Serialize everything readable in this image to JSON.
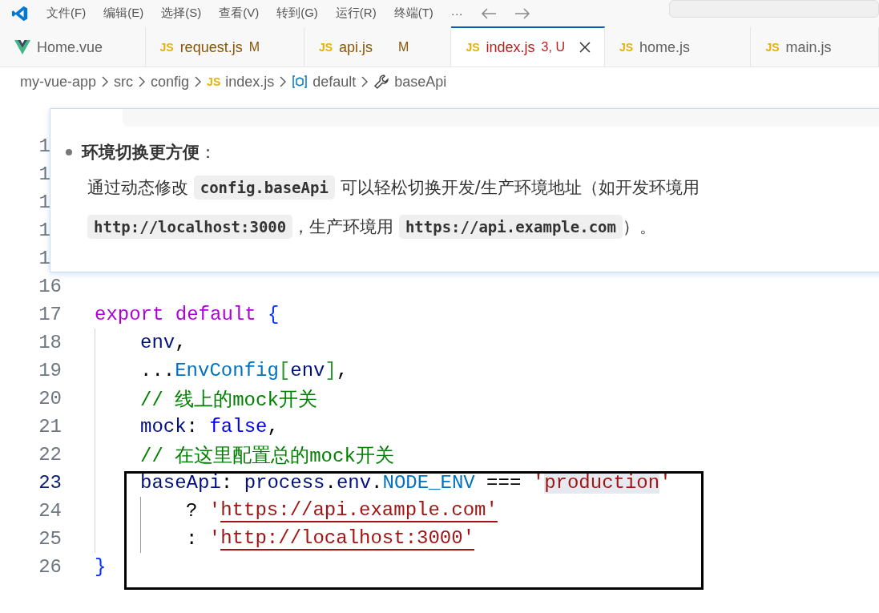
{
  "menu_bar": {
    "items": [
      "文件(F)",
      "编辑(E)",
      "选择(S)",
      "查看(V)",
      "转到(G)",
      "运行(R)",
      "终端(T)",
      "···"
    ]
  },
  "tabs": [
    {
      "label": "Home.vue",
      "selected": false,
      "error": false
    },
    {
      "label": "request.js",
      "icon_text": "JS",
      "status": "M",
      "selected": false,
      "error": false
    },
    {
      "label": "api.js",
      "icon_text": "JS",
      "status": "M",
      "selected": false,
      "error": false
    },
    {
      "label": "index.js",
      "icon_text": "JS",
      "status": "3, U",
      "selected": true,
      "error": true
    },
    {
      "label": "home.js",
      "icon_text": "JS",
      "selected": false,
      "error": false
    },
    {
      "label": "main.js",
      "icon_text": "JS",
      "selected": false,
      "error": false
    }
  ],
  "breadcrumb": [
    {
      "label": "my-vue-app",
      "kind": "folder"
    },
    {
      "label": "src",
      "kind": "folder"
    },
    {
      "label": "config",
      "kind": "folder"
    },
    {
      "label": "index.js",
      "kind": "file",
      "icon_text": "JS"
    },
    {
      "label": "default",
      "kind": "module"
    },
    {
      "label": "baseApi",
      "kind": "property"
    }
  ],
  "editor": {
    "covered_line_numbers": [
      "1",
      "1",
      "1",
      "1",
      "1"
    ],
    "lines": [
      {
        "number": "16",
        "current": false
      },
      {
        "number": "17",
        "current": false,
        "tokens": [
          {
            "text": "export default ",
            "kind": "keyword"
          },
          {
            "text": "{",
            "kind": "brace"
          }
        ],
        "children": [
          {
            "number": "18",
            "current": false,
            "tokens": [
              {
                "text": "env",
                "kind": "variable"
              },
              {
                "text": ",",
                "kind": "plain"
              }
            ]
          },
          {
            "number": "19",
            "current": false,
            "tokens": [
              {
                "text": "...",
                "kind": "plain"
              },
              {
                "text": "EnvConfig",
                "kind": "constant"
              },
              {
                "text": "[",
                "kind": "bracket"
              },
              {
                "text": "env",
                "kind": "variable"
              },
              {
                "text": "]",
                "kind": "bracket"
              },
              {
                "text": ",",
                "kind": "plain"
              }
            ]
          },
          {
            "number": "20",
            "current": false,
            "tokens": [
              {
                "text": "// 线上的mock开关",
                "kind": "comment"
              }
            ]
          },
          {
            "number": "21",
            "current": false,
            "tokens": [
              {
                "text": "mock",
                "kind": "variable"
              },
              {
                "text": ": ",
                "kind": "plain"
              },
              {
                "text": "false",
                "kind": "boolean"
              },
              {
                "text": ",",
                "kind": "plain"
              }
            ]
          },
          {
            "number": "22",
            "current": false,
            "tokens": [
              {
                "text": "// 在这里配置总的mock开关",
                "kind": "comment"
              }
            ]
          },
          {
            "number": "23",
            "current": true,
            "tokens": [
              {
                "text": "baseApi",
                "kind": "variable"
              },
              {
                "text": ": ",
                "kind": "plain"
              },
              {
                "text": "process",
                "kind": "variable"
              },
              {
                "text": ".",
                "kind": "plain"
              },
              {
                "text": "env",
                "kind": "variable"
              },
              {
                "text": ".",
                "kind": "plain"
              },
              {
                "text": "NODE_ENV",
                "kind": "constant"
              },
              {
                "text": " === ",
                "kind": "plain"
              },
              {
                "text": "'",
                "kind": "string"
              },
              {
                "text": "production",
                "kind": "string",
                "highlighted": true
              },
              {
                "text": "'",
                "kind": "string"
              }
            ],
            "children": [
              {
                "number": "24",
                "current": false,
                "tokens": [
                  {
                    "text": "? ",
                    "kind": "plain"
                  },
                  {
                    "text": "'",
                    "kind": "string"
                  },
                  {
                    "text": "https://api.example.com'",
                    "kind": "string",
                    "underlined": true
                  }
                ]
              },
              {
                "number": "25",
                "current": false,
                "tokens": [
                  {
                    "text": ": ",
                    "kind": "plain"
                  },
                  {
                    "text": "'",
                    "kind": "string"
                  },
                  {
                    "text": "http://localhost:3000'",
                    "kind": "string",
                    "underlined": true
                  }
                ]
              }
            ]
          }
        ]
      },
      {
        "number": "26",
        "current": false,
        "tokens": [
          {
            "text": "}",
            "kind": "brace"
          }
        ]
      }
    ]
  },
  "hover_popup": {
    "heading": "**环境切换更方便**：",
    "paragraph": [
      {
        "text": "通过动态修改 ",
        "code": false
      },
      {
        "text": "config.baseApi",
        "code": true
      },
      {
        "text": " 可以轻松切换开发/生产环境地址（如开发环境用 ",
        "code": false
      },
      {
        "text": "http://localhost:3000",
        "code": true
      },
      {
        "text": "，生产环境用 ",
        "code": false
      },
      {
        "text": "https://api.example.com",
        "code": true
      },
      {
        "text": "）。",
        "code": false
      }
    ]
  }
}
